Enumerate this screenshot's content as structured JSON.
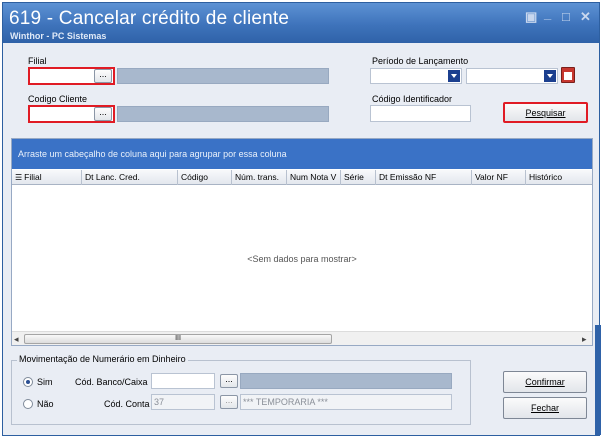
{
  "window": {
    "title": "619 - Cancelar crédito de cliente",
    "subtitle": "Winthor - PC Sistemas",
    "controls": {
      "restore": "▣",
      "minimize": "_",
      "maximize": "□",
      "close": "✕"
    }
  },
  "filters": {
    "filial_label": "Filial",
    "codigo_cliente_label": "Codigo Cliente",
    "periodo_label": "Período de Lançamento",
    "codigo_identificador_label": "Código Identificador",
    "lookup_button": "...",
    "pesquisar_button": "Pesquisar"
  },
  "grid": {
    "group_hint": "Arraste um cabeçalho de coluna aqui para agrupar por essa coluna",
    "columns": [
      "Filial",
      "Dt Lanc. Cred.",
      "Código",
      "Núm. trans.",
      "Num Nota V",
      "Série",
      "Dt Emissão NF",
      "Valor NF",
      "Histórico"
    ],
    "empty_message": "<Sem dados para mostrar>",
    "scroll_grip": "III"
  },
  "movimentacao": {
    "legend": "Movimentação de Numerário em Dinheiro",
    "sim_label": "Sim",
    "nao_label": "Não",
    "cod_banco_label": "Cód. Banco/Caixa",
    "cod_conta_label": "Cód. Conta",
    "cod_conta_value": "37",
    "conta_desc_value": "*** TEMPORARIA ***",
    "selected": "Sim"
  },
  "actions": {
    "confirmar_button": "Confirmar",
    "fechar_button": "Fechar"
  },
  "colors": {
    "title_bar": "#3e73bb",
    "group_bar": "#3a72c6",
    "highlight_border": "#e01b24"
  }
}
